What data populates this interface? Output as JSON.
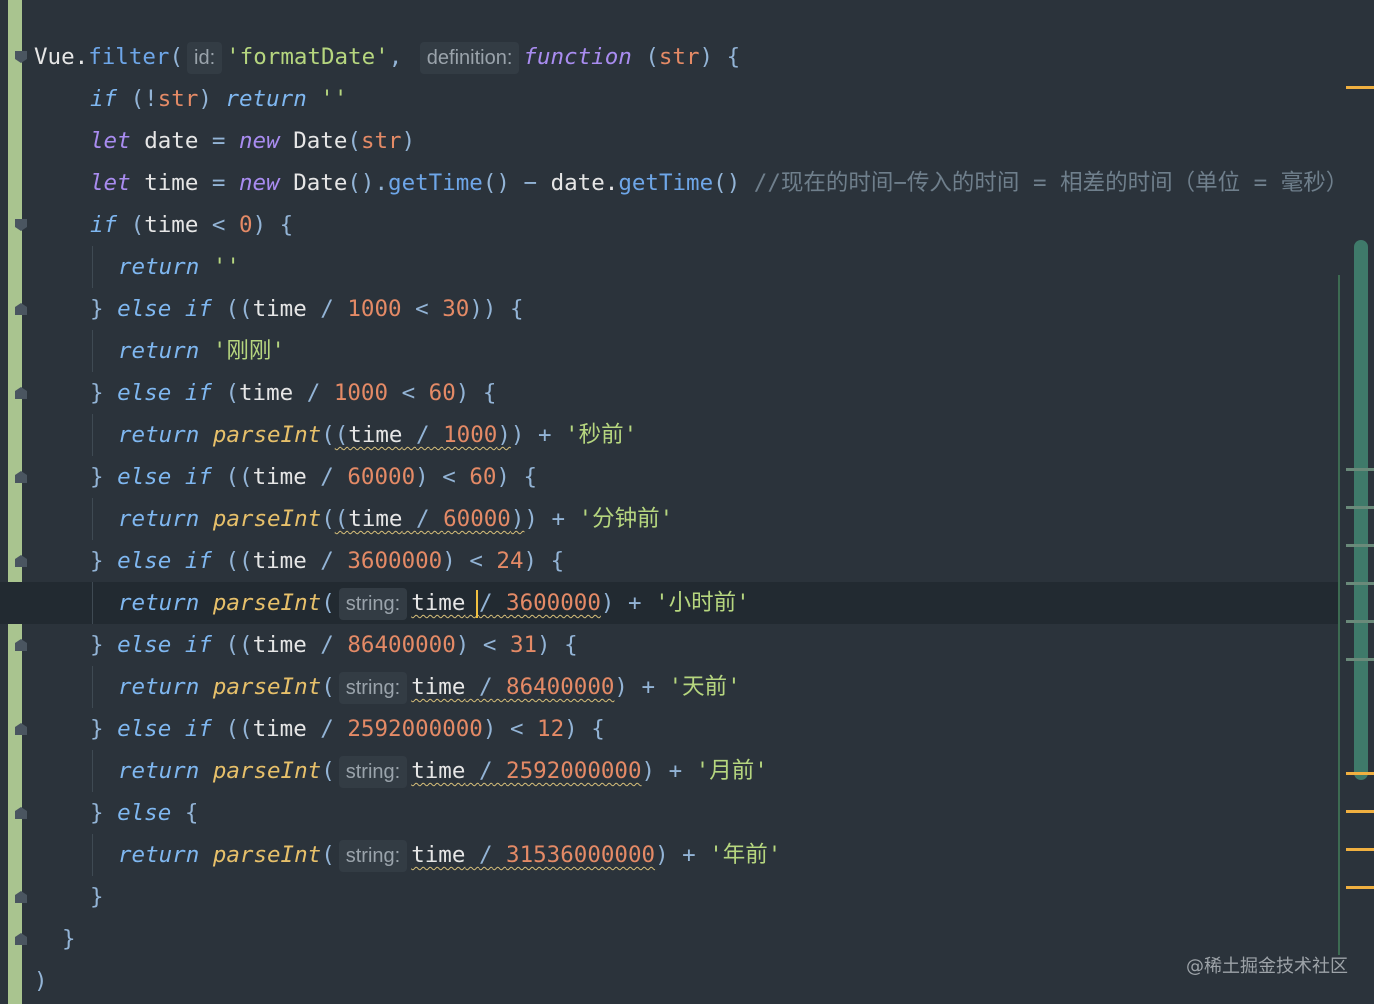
{
  "editor": {
    "hints": {
      "id": "id:",
      "definition": "definition:",
      "string": "string:"
    },
    "watermark": "@稀土掘金技术社区",
    "colors": {
      "background": "#2b333b",
      "gutter": "#a9c48f",
      "scroll_thumb": "#3f7a6a",
      "marker_warning": "#f0b040",
      "marker_info": "#6a8a7a"
    }
  }
}
